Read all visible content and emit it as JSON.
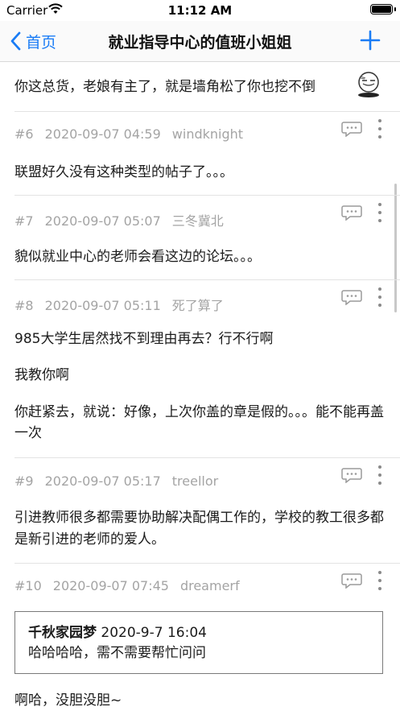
{
  "status_bar": {
    "carrier": "Carrier",
    "time": "11:12 AM"
  },
  "nav": {
    "back_label": "首页",
    "title": "就业指导中心的值班小姐姐"
  },
  "top_post": {
    "text": "你这总货，老娘有主了，就是墙角松了你也挖不倒"
  },
  "posts": [
    {
      "floor": "#6",
      "time": "2020-09-07 04:59",
      "user": "windknight",
      "lines": [
        "联盟好久没有这种类型的帖子了。。。"
      ]
    },
    {
      "floor": "#7",
      "time": "2020-09-07 05:07",
      "user": "三冬冀北",
      "lines": [
        "貌似就业中心的老师会看这边的论坛。。。"
      ]
    },
    {
      "floor": "#8",
      "time": "2020-09-07 05:11",
      "user": "死了算了",
      "lines": [
        "985大学生居然找不到理由再去？行不行啊",
        "我教你啊",
        "你赶紧去，就说：好像，上次你盖的章是假的。。。能不能再盖一次"
      ]
    },
    {
      "floor": "#9",
      "time": "2020-09-07 05:17",
      "user": "treellor",
      "lines": [
        "引进教师很多都需要协助解决配偶工作的，学校的教工很多都是新引进的老师的爱人。"
      ]
    },
    {
      "floor": "#10",
      "time": "2020-09-07 07:45",
      "user": "dreamerf",
      "quote": {
        "author": "千秋家园梦",
        "date": "2020-9-7 16:04",
        "text": "哈哈哈哈，需不需要帮忙问问"
      },
      "lines": [
        "啊哈，没胆没胆~"
      ]
    }
  ],
  "icons": {
    "back": "chevron-left-icon",
    "add": "plus-icon",
    "reply": "comment-bubble-icon",
    "more": "more-vertical-icon",
    "emoji": "sleepy-face-icon",
    "wifi": "wifi-icon",
    "battery": "battery-icon"
  },
  "colors": {
    "accent": "#1a7cf5",
    "meta": "#a4a4a4",
    "text": "#1b1b1b"
  }
}
